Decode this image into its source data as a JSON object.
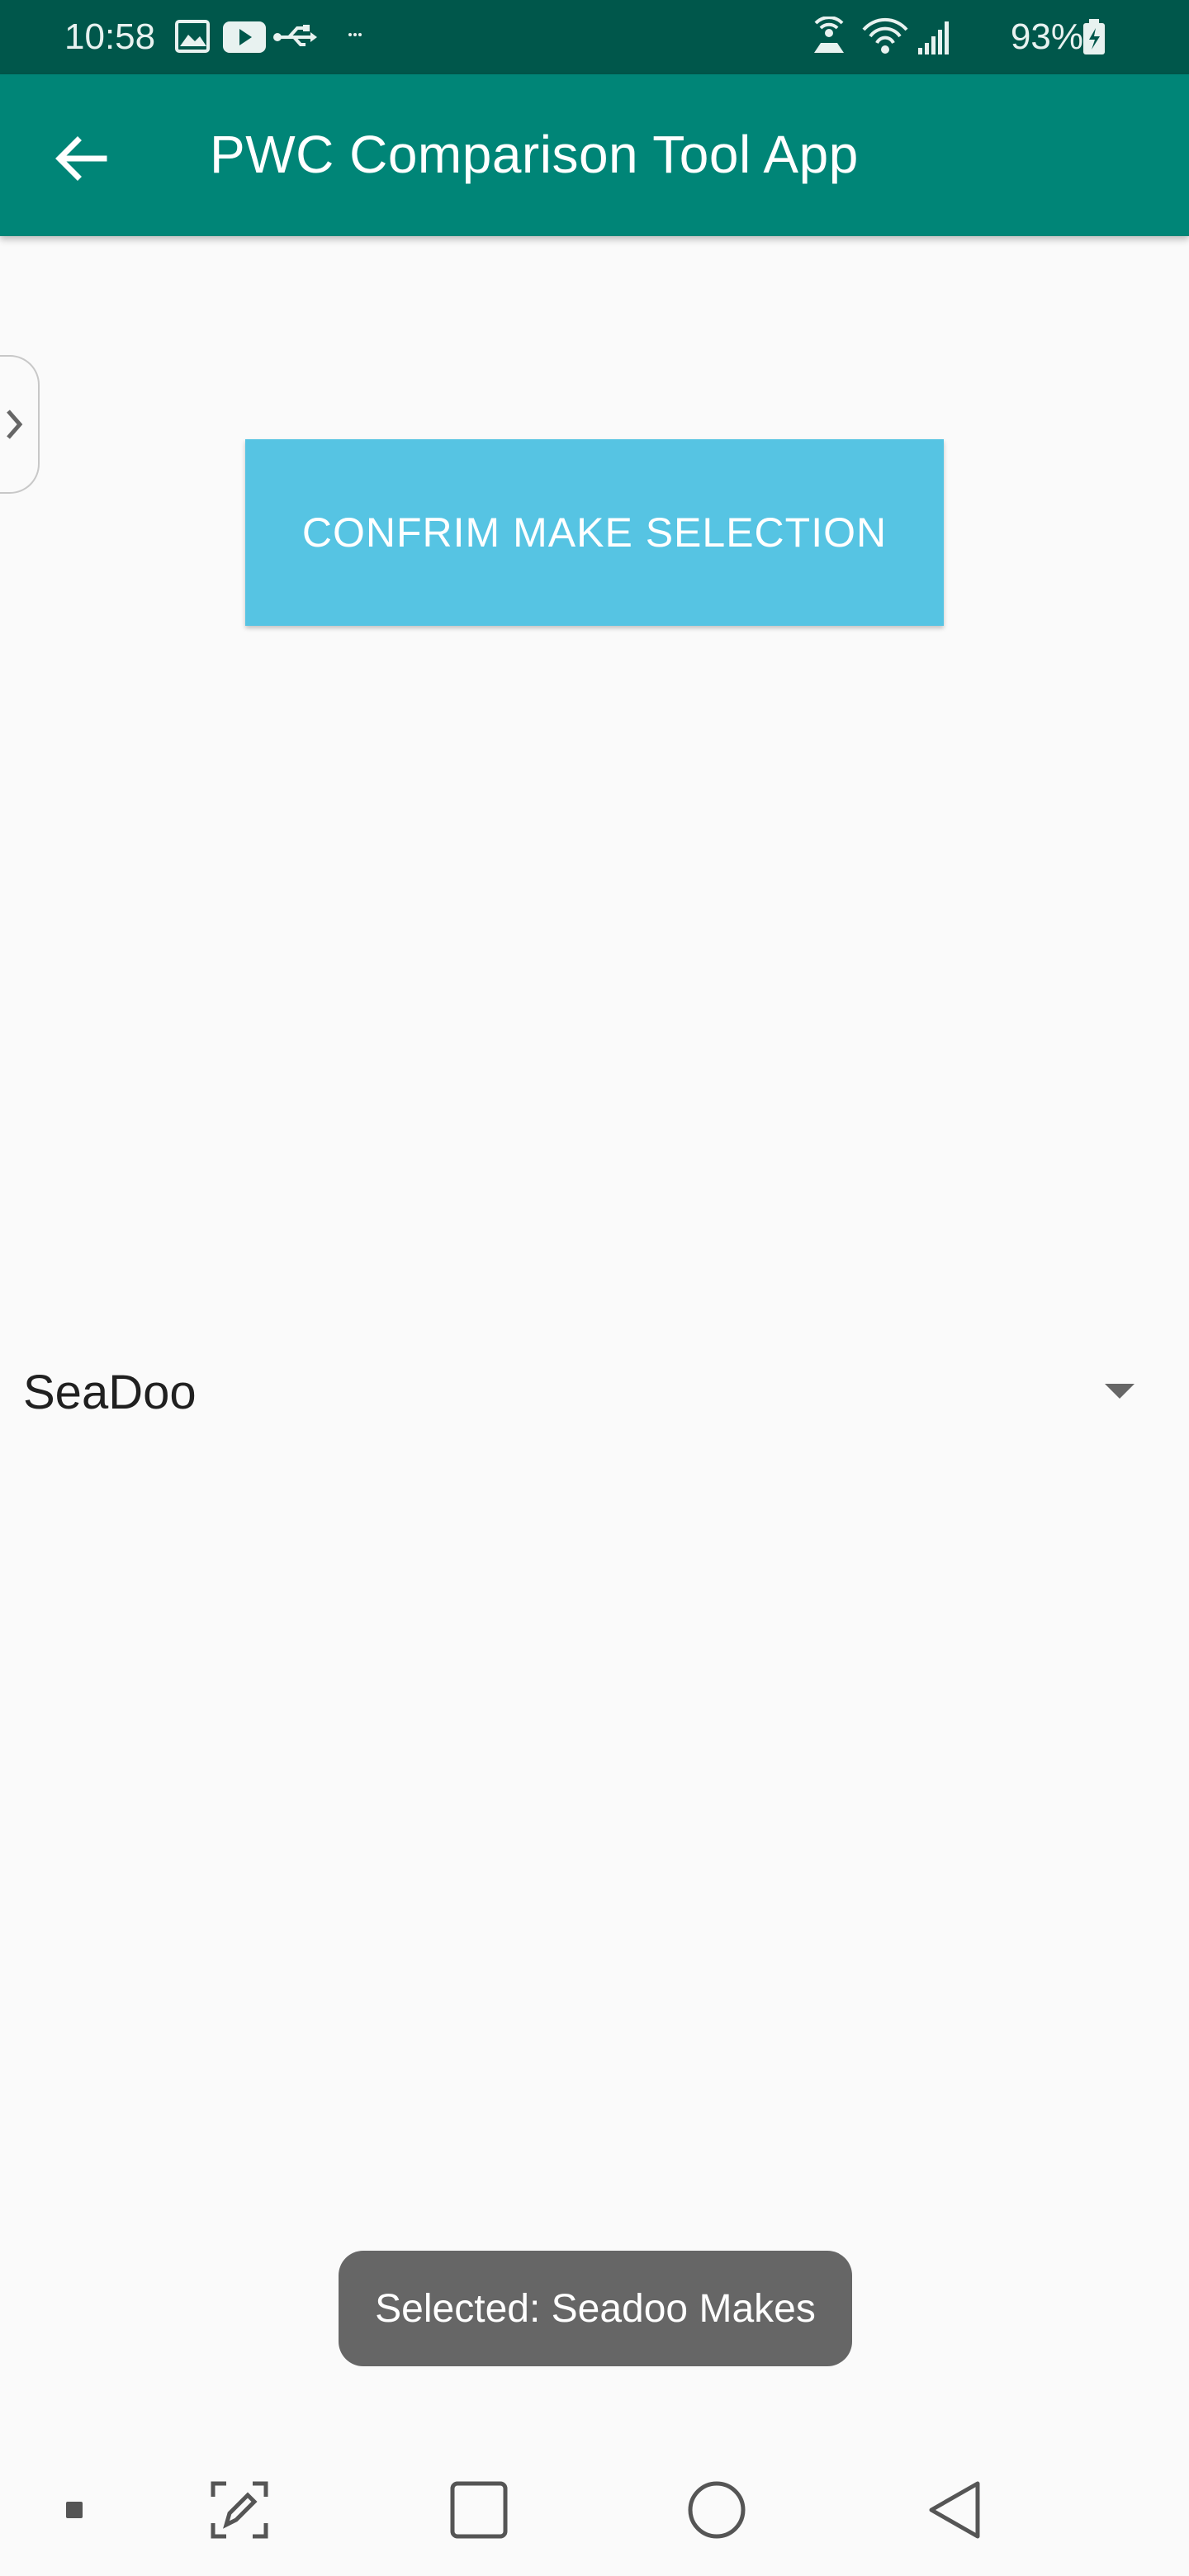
{
  "status_bar": {
    "time": "10:58",
    "battery": "93%",
    "left_icons": [
      "gallery-icon",
      "youtube-icon",
      "usb-icon",
      "more-notifications-icon"
    ],
    "right_icons": [
      "hotspot-icon",
      "wifi-icon",
      "signal-icon",
      "battery-icon"
    ]
  },
  "app_bar": {
    "title": "PWC Comparison Tool App",
    "back_icon": "back-arrow-icon",
    "background": "#008577"
  },
  "main": {
    "confirm_button_label": "CONFRIM MAKE SELECTION",
    "confirm_button_color": "#56c4e3",
    "make_spinner": {
      "selected": "SeaDoo"
    }
  },
  "toast": {
    "text": "Selected: Seadoo Makes"
  },
  "nav_bar": {
    "icons": [
      "nav-dot-icon",
      "screen-write-icon",
      "recents-icon",
      "home-icon",
      "back-icon"
    ]
  }
}
